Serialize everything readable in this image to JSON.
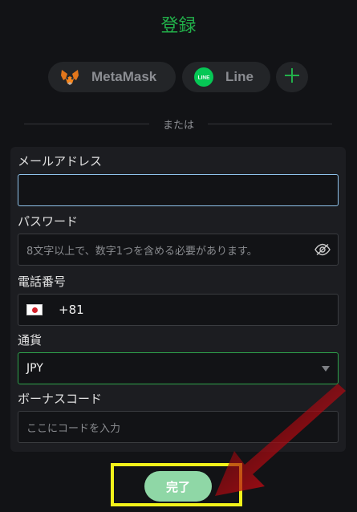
{
  "page": {
    "title": "登録"
  },
  "social": {
    "metamask_label": "MetaMask",
    "line_label": "Line",
    "line_icon_text": "LINE",
    "more_icon": "plus-icon"
  },
  "divider": {
    "or_text": "または"
  },
  "form": {
    "email": {
      "label": "メールアドレス",
      "value": "",
      "placeholder": ""
    },
    "password": {
      "label": "パスワード",
      "placeholder": "8文字以上で、数字1つを含める必要があります。",
      "toggle_icon": "eye-slash-icon"
    },
    "phone": {
      "label": "電話番号",
      "country_flag": "jp-flag-icon",
      "dial_code": "+81"
    },
    "currency": {
      "label": "通貨",
      "selected": "JPY"
    },
    "bonus": {
      "label": "ボーナスコード",
      "placeholder": "ここにコードを入力"
    },
    "submit_label": "完了"
  },
  "colors": {
    "accent_green": "#22b04a",
    "submit_bg": "#8fd7a6",
    "highlight_yellow": "#f2f21a",
    "arrow_red": "#d4101a"
  }
}
